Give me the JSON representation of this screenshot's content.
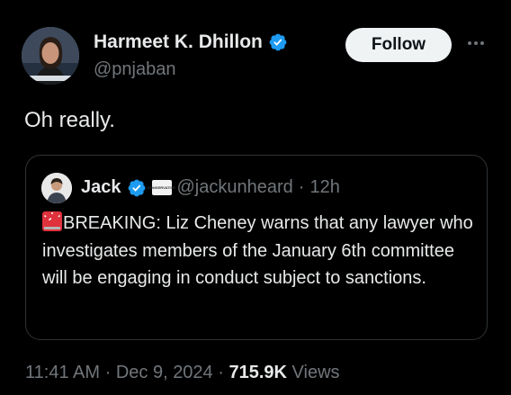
{
  "tweet": {
    "author_name": "Harmeet K. Dhillon",
    "author_handle": "@pnjaban",
    "follow_label": "Follow",
    "text": "Oh really."
  },
  "quoted": {
    "name": "Jack",
    "affiliation_label": "CONSERVATIVE",
    "handle": "@jackunheard",
    "separator": "·",
    "time": "12h",
    "body_prefix": "BREAKING:",
    "body": " Liz Cheney warns that any lawyer who investigates members of the January 6th committee will be engaging in conduct subject to sanctions."
  },
  "meta": {
    "time": "11:41 AM",
    "sep1": "·",
    "date": "Dec 9, 2024",
    "sep2": "·",
    "views_count": "715.9K",
    "views_label": "Views"
  },
  "icons": {
    "verified": "verified-badge-icon",
    "more": "more-horizontal-icon",
    "siren": "rotating-light-emoji"
  },
  "colors": {
    "background": "#000000",
    "text": "#e7e9ea",
    "secondary": "#71767b",
    "verified_blue": "#1d9bf0",
    "border": "#2f3336"
  }
}
